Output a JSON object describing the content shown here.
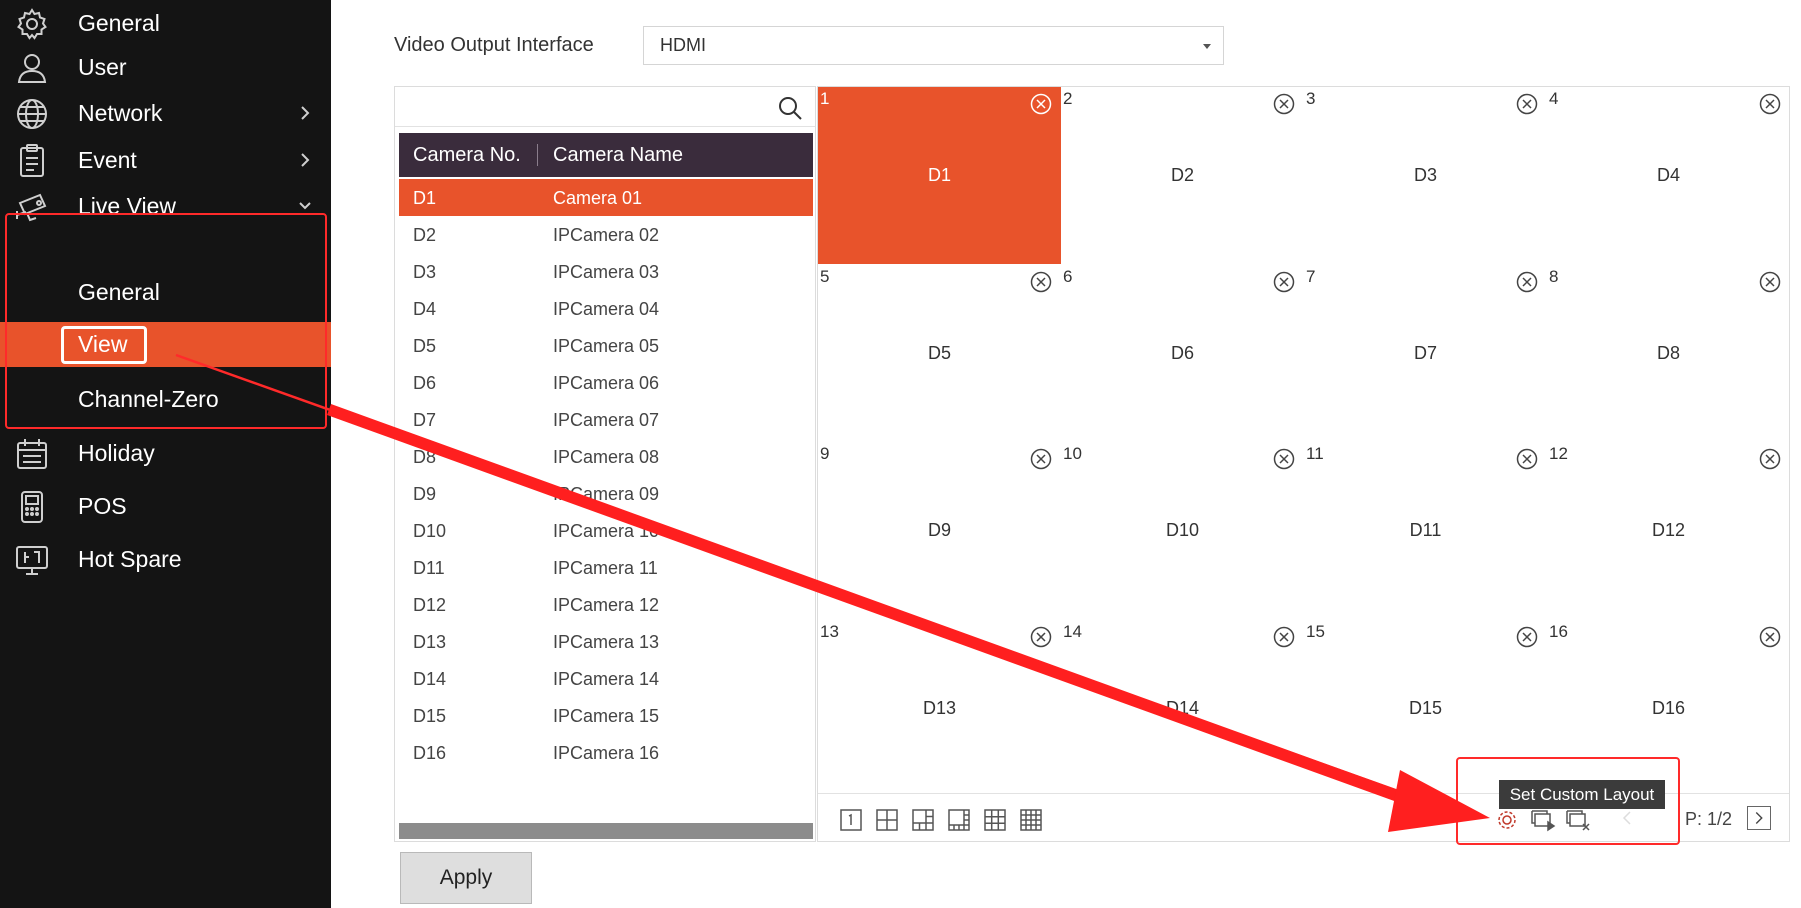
{
  "sidebar": {
    "items": [
      {
        "label": "General",
        "icon": "gear-icon"
      },
      {
        "label": "User",
        "icon": "user-icon"
      },
      {
        "label": "Network",
        "icon": "globe-icon"
      },
      {
        "label": "Event",
        "icon": "clipboard-icon"
      },
      {
        "label": "Live View",
        "icon": "camera-icon"
      },
      {
        "label": "General"
      },
      {
        "label": "View"
      },
      {
        "label": "Channel-Zero"
      },
      {
        "label": "Holiday",
        "icon": "calendar-icon"
      },
      {
        "label": "POS",
        "icon": "pos-terminal-icon"
      },
      {
        "label": "Hot Spare",
        "icon": "monitor-icon"
      }
    ]
  },
  "main": {
    "video_output": {
      "label": "Video Output Interface",
      "value": "HDMI"
    },
    "camera_table": {
      "headers": [
        "Camera No.",
        "Camera Name"
      ],
      "rows": [
        {
          "no": "D1",
          "name": "Camera 01"
        },
        {
          "no": "D2",
          "name": "IPCamera 02"
        },
        {
          "no": "D3",
          "name": "IPCamera 03"
        },
        {
          "no": "D4",
          "name": "IPCamera 04"
        },
        {
          "no": "D5",
          "name": "IPCamera 05"
        },
        {
          "no": "D6",
          "name": "IPCamera 06"
        },
        {
          "no": "D7",
          "name": "IPCamera 07"
        },
        {
          "no": "D8",
          "name": "IPCamera 08"
        },
        {
          "no": "D9",
          "name": "IPCamera 09"
        },
        {
          "no": "D10",
          "name": "IPCamera 10"
        },
        {
          "no": "D11",
          "name": "IPCamera 11"
        },
        {
          "no": "D12",
          "name": "IPCamera 12"
        },
        {
          "no": "D13",
          "name": "IPCamera 13"
        },
        {
          "no": "D14",
          "name": "IPCamera 14"
        },
        {
          "no": "D15",
          "name": "IPCamera 15"
        },
        {
          "no": "D16",
          "name": "IPCamera 16"
        }
      ]
    },
    "grid": {
      "cells": [
        {
          "num": "1",
          "label": "D1"
        },
        {
          "num": "2",
          "label": "D2"
        },
        {
          "num": "3",
          "label": "D3"
        },
        {
          "num": "4",
          "label": "D4"
        },
        {
          "num": "5",
          "label": "D5"
        },
        {
          "num": "6",
          "label": "D6"
        },
        {
          "num": "7",
          "label": "D7"
        },
        {
          "num": "8",
          "label": "D8"
        },
        {
          "num": "9",
          "label": "D9"
        },
        {
          "num": "10",
          "label": "D10"
        },
        {
          "num": "11",
          "label": "D11"
        },
        {
          "num": "12",
          "label": "D12"
        },
        {
          "num": "13",
          "label": "D13"
        },
        {
          "num": "14",
          "label": "D14"
        },
        {
          "num": "15",
          "label": "D15"
        },
        {
          "num": "16",
          "label": "D16"
        }
      ],
      "toolbar": {
        "tooltip": "Set Custom Layout",
        "page": "P: 1/2"
      }
    },
    "apply_label": "Apply"
  },
  "colors": {
    "accent": "#e8532b",
    "sidebar_bg": "#141414",
    "table_header_bg": "#3a2c3c",
    "annotation_red": "#ff2a2a"
  }
}
